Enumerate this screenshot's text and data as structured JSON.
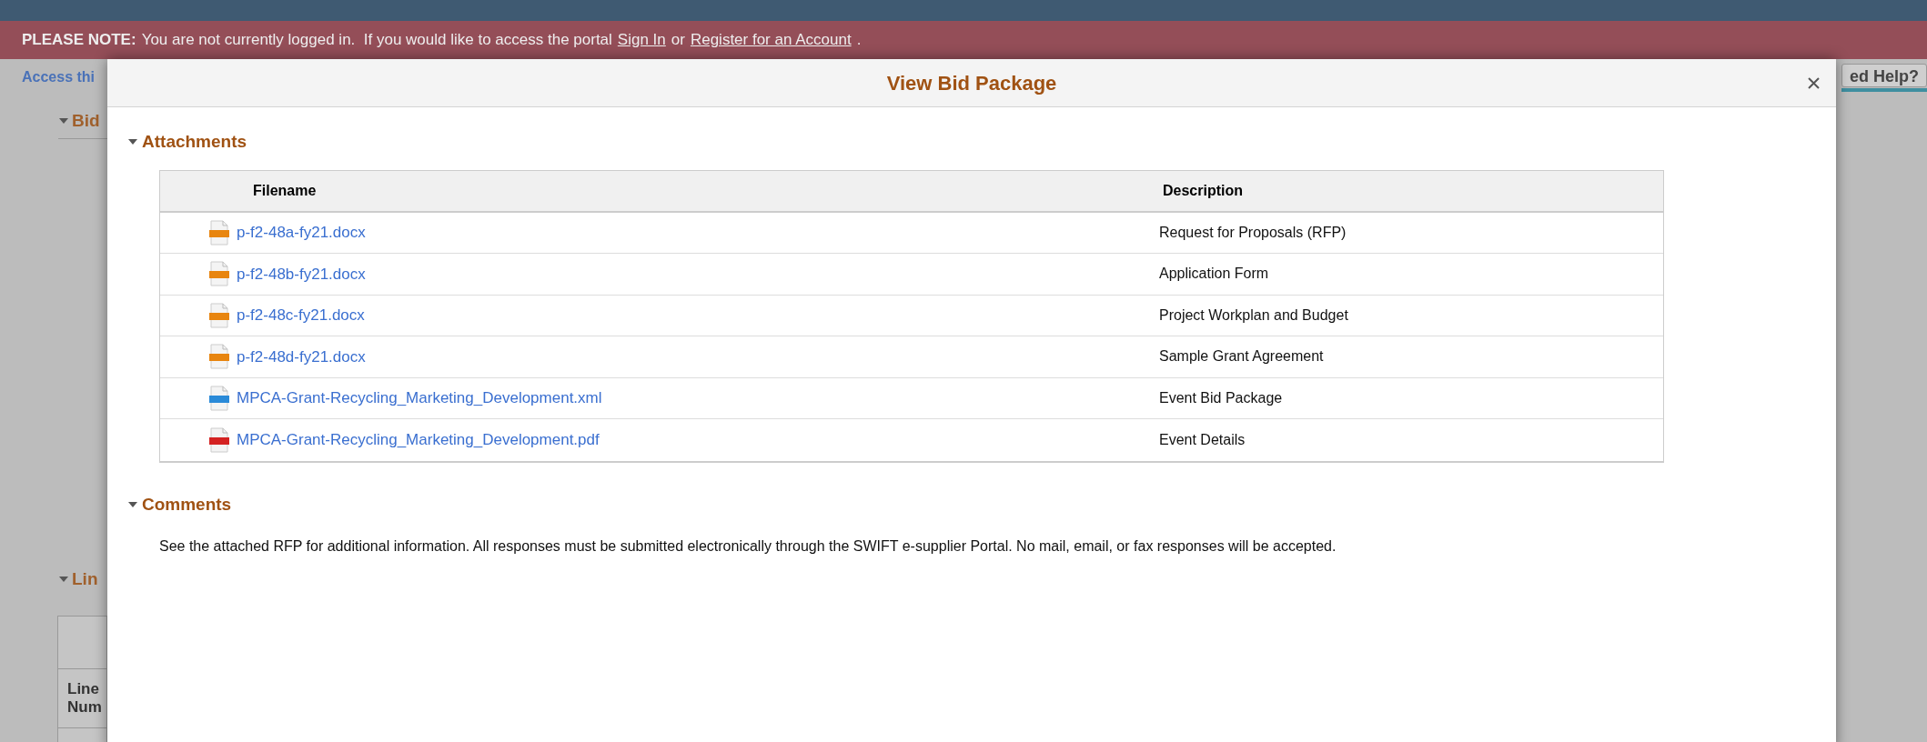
{
  "banner": {
    "label": "PLEASE NOTE:",
    "segments": [
      {
        "kind": "text",
        "text": "You are not currently logged in.  If you would like to access the portal"
      },
      {
        "kind": "link",
        "text": "Sign In"
      },
      {
        "kind": "text",
        "text": "or"
      },
      {
        "kind": "link",
        "text": "Register for an Account"
      },
      {
        "kind": "text",
        "text": "."
      }
    ]
  },
  "background": {
    "access_link": "Access thi",
    "help_button": "ed Help?",
    "sections": [
      {
        "title": "Bid",
        "expanded": true
      },
      {
        "title": "Lin",
        "expanded": true
      }
    ],
    "table_header": "Line\nNum"
  },
  "dialog": {
    "title": "View Bid Package",
    "attachments": {
      "title": "Attachments",
      "expanded": true,
      "columns": [
        "Filename",
        "Description"
      ],
      "rows": [
        {
          "kind": "doc",
          "filename": "p-f2-48a-fy21.docx",
          "description": "Request for Proposals (RFP)"
        },
        {
          "kind": "doc",
          "filename": "p-f2-48b-fy21.docx",
          "description": "Application Form"
        },
        {
          "kind": "doc",
          "filename": "p-f2-48c-fy21.docx",
          "description": "Project Workplan and Budget"
        },
        {
          "kind": "doc",
          "filename": "p-f2-48d-fy21.docx",
          "description": "Sample Grant Agreement"
        },
        {
          "kind": "html",
          "filename": "MPCA-Grant-Recycling_Marketing_Development.xml",
          "description": "Event Bid Package"
        },
        {
          "kind": "pdf",
          "filename": "MPCA-Grant-Recycling_Marketing_Development.pdf",
          "description": "Event Details"
        }
      ]
    },
    "comments": {
      "title": "Comments",
      "expanded": true,
      "text": "See the attached RFP for additional information. All responses must be submitted electronically through the SWIFT e-supplier Portal. No mail, email, or fax responses will be accepted."
    }
  }
}
